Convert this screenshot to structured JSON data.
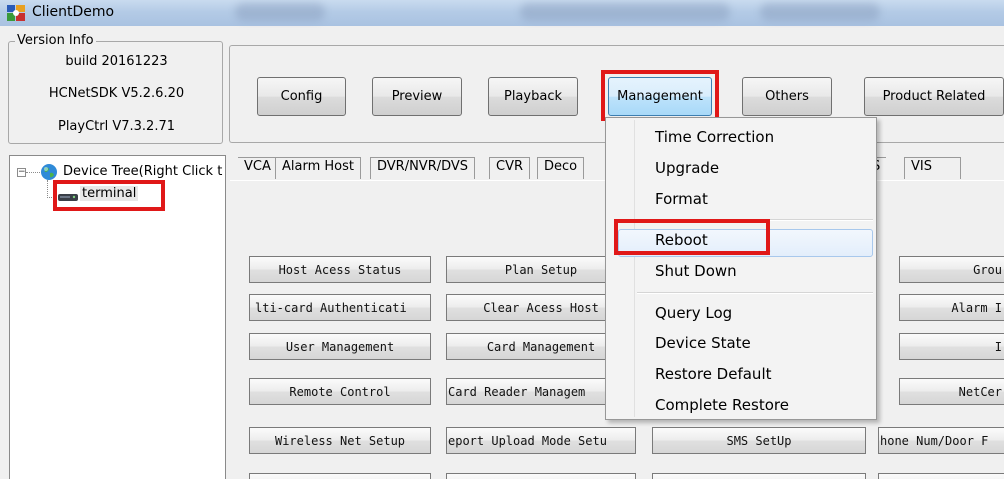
{
  "window": {
    "title": "ClientDemo"
  },
  "version_info": {
    "legend": "Version Info",
    "build": "build 20161223",
    "sdk": "HCNetSDK V5.2.6.20",
    "playctrl": "PlayCtrl V7.3.2.71"
  },
  "toolbar": {
    "config": "Config",
    "preview": "Preview",
    "playback": "Playback",
    "management": "Management",
    "others": "Others",
    "product_related": "Product Related"
  },
  "tree": {
    "root": "Device Tree(Right Click t",
    "expander": "−",
    "terminal": "terminal"
  },
  "tabs": [
    "VCA",
    "Alarm Host",
    "DVR/NVR/DVS",
    "CVR",
    "Deco",
    "S",
    "VIS"
  ],
  "buttons": {
    "col1": [
      "Host Acess Status",
      "lti-card Authenticati",
      "User Management",
      "Remote Control",
      "Wireless Net Setup"
    ],
    "col2": [
      "Plan Setup",
      "Clear Acess Host",
      "Card Management",
      "Card Reader Managem",
      "eport Upload Mode Setu"
    ],
    "col3": [
      "SMS SetUp"
    ],
    "col4": [
      "Grou",
      "Alarm I",
      "I",
      "NetCer",
      "hone Num/Door F"
    ]
  },
  "menu": {
    "items": [
      "Time Correction",
      "Upgrade",
      "Format",
      "Reboot",
      "Shut Down",
      "Query Log",
      "Device State",
      "Restore Default",
      "Complete Restore"
    ],
    "hovered": "Reboot"
  },
  "colors": {
    "highlight": "#e01818",
    "menu_hover_border": "#a8c8ec"
  }
}
